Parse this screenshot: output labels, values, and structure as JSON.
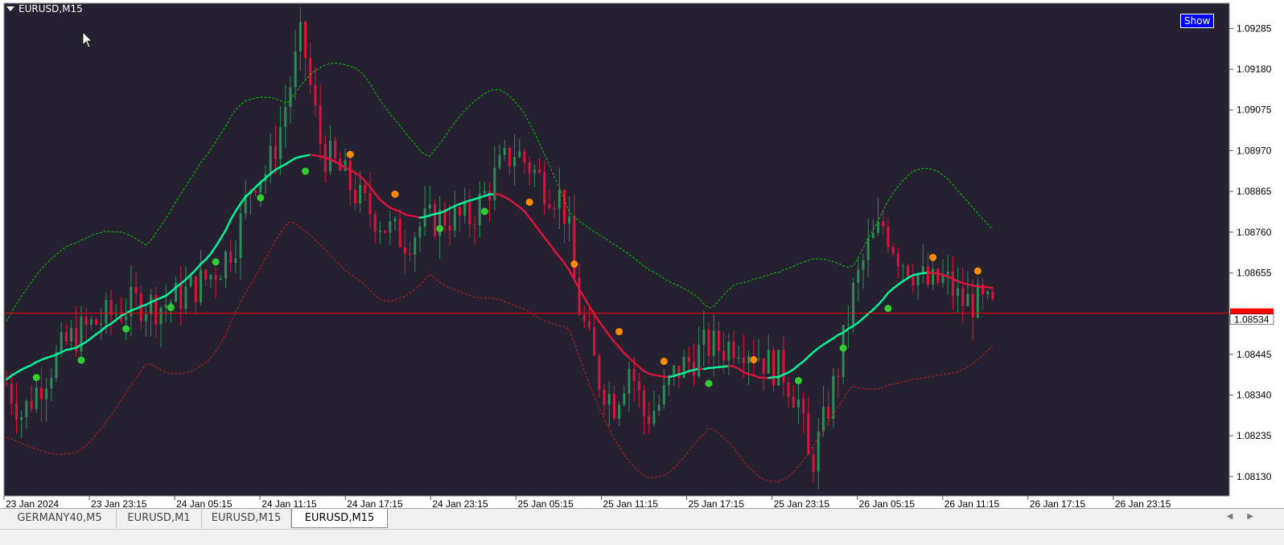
{
  "window": {
    "symbol_label": "EURUSD,M15",
    "show_button": "Show"
  },
  "tabs": [
    {
      "label": "GERMANY40,M5",
      "active": false
    },
    {
      "label": "EURUSD,M1",
      "active": false
    },
    {
      "label": "EURUSD,M15",
      "active": false
    },
    {
      "label": "EURUSD,M15",
      "active": true
    }
  ],
  "colors": {
    "background": "#252130",
    "bull_candle": "#2e8b57",
    "bear_candle": "#dc143c",
    "ma_up": "#00fa9a",
    "ma_down": "#dc143c",
    "upper_band": "#00c800",
    "lower_band": "#c81e1e",
    "price_line": "#ff0000",
    "signal_orange": "#ff8c00",
    "signal_green": "#32cd32"
  },
  "chart_data": {
    "type": "candlestick",
    "symbol": "EURUSD",
    "timeframe": "M15",
    "current_price": 1.08551,
    "bid_price_label": "1.08534",
    "ylim": [
      1.0808,
      1.0935
    ],
    "y_ticks": [
      "1.09285",
      "1.09180",
      "1.09075",
      "1.08970",
      "1.08865",
      "1.08760",
      "1.08655",
      "1.08445",
      "1.08340",
      "1.08235",
      "1.08130"
    ],
    "x_labels": [
      "23 Jan 2024",
      "23 Jan 23:15",
      "24 Jan 05:15",
      "24 Jan 11:15",
      "24 Jan 17:15",
      "24 Jan 23:15",
      "25 Jan 05:15",
      "25 Jan 11:15",
      "25 Jan 17:15",
      "25 Jan 23:15",
      "26 Jan 05:15",
      "26 Jan 11:15",
      "26 Jan 17:15",
      "26 Jan 23:15"
    ],
    "bars": 246,
    "close_path": [
      [
        0,
        1.0837
      ],
      [
        10,
        1.0829
      ],
      [
        25,
        1.0839
      ],
      [
        40,
        1.0848
      ],
      [
        55,
        1.0852
      ],
      [
        70,
        1.0855
      ],
      [
        85,
        1.0858
      ],
      [
        100,
        1.0857
      ],
      [
        115,
        1.086
      ],
      [
        130,
        1.0864
      ],
      [
        140,
        1.0868
      ],
      [
        150,
        1.0875
      ],
      [
        155,
        1.0883
      ],
      [
        160,
        1.089
      ],
      [
        170,
        1.0892
      ],
      [
        178,
        1.0903
      ],
      [
        185,
        1.0915
      ],
      [
        192,
        1.0927
      ],
      [
        198,
        1.0912
      ],
      [
        205,
        1.0897
      ],
      [
        212,
        1.0894
      ],
      [
        220,
        1.089
      ],
      [
        230,
        1.0884
      ],
      [
        240,
        1.088
      ],
      [
        250,
        1.0876
      ],
      [
        260,
        1.0874
      ],
      [
        270,
        1.0878
      ],
      [
        285,
        1.088
      ],
      [
        300,
        1.0879
      ],
      [
        310,
        1.0885
      ],
      [
        320,
        1.0892
      ],
      [
        330,
        1.0897
      ],
      [
        340,
        1.0893
      ],
      [
        350,
        1.0888
      ],
      [
        360,
        1.0885
      ],
      [
        365,
        1.0878
      ],
      [
        370,
        1.086
      ],
      [
        378,
        1.0848
      ],
      [
        385,
        1.0838
      ],
      [
        395,
        1.0832
      ],
      [
        405,
        1.0842
      ],
      [
        415,
        1.0828
      ],
      [
        425,
        1.0832
      ],
      [
        435,
        1.084
      ],
      [
        445,
        1.0843
      ],
      [
        455,
        1.0847
      ],
      [
        465,
        1.0846
      ],
      [
        475,
        1.0848
      ],
      [
        485,
        1.0846
      ],
      [
        495,
        1.0842
      ],
      [
        505,
        1.084
      ],
      [
        515,
        1.0832
      ],
      [
        522,
        1.0815
      ],
      [
        530,
        1.0825
      ],
      [
        540,
        1.084
      ],
      [
        550,
        1.086
      ],
      [
        560,
        1.0872
      ],
      [
        570,
        1.0878
      ],
      [
        580,
        1.087
      ],
      [
        590,
        1.0866
      ],
      [
        600,
        1.0862
      ],
      [
        610,
        1.0864
      ],
      [
        620,
        1.0858
      ],
      [
        630,
        1.0858
      ],
      [
        640,
        1.0856
      ],
      [
        645,
        1.0855
      ]
    ],
    "series": [
      {
        "name": "moving_average"
      },
      {
        "name": "upper_band"
      },
      {
        "name": "lower_band"
      }
    ]
  }
}
